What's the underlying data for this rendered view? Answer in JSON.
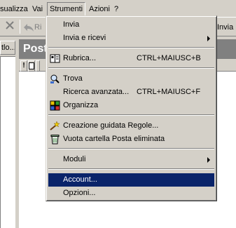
{
  "menubar": {
    "items": [
      {
        "label": "sualizza"
      },
      {
        "label": "Vai"
      },
      {
        "label": "Strumenti"
      },
      {
        "label": "Azioni"
      },
      {
        "label": "?"
      }
    ]
  },
  "toolbar": {
    "left_label": "Ri",
    "right_label": "Invia"
  },
  "leftpane": {
    "header": "tlo..."
  },
  "main": {
    "header": "Post",
    "columns": [
      "!",
      "☐",
      "✉"
    ]
  },
  "menu": {
    "items": [
      {
        "label": "Invia",
        "shortcut": "",
        "icon": "",
        "submenu": false
      },
      {
        "label": "Invia e ricevi",
        "shortcut": "",
        "icon": "",
        "submenu": true
      },
      {
        "label": "Rubrica...",
        "shortcut": "CTRL+MAIUSC+B",
        "icon": "address-book-icon",
        "submenu": false
      },
      {
        "label": "Trova",
        "shortcut": "",
        "icon": "find-icon",
        "submenu": false
      },
      {
        "label": "Ricerca avanzata...",
        "shortcut": "CTRL+MAIUSC+F",
        "icon": "",
        "submenu": false
      },
      {
        "label": "Organizza",
        "shortcut": "",
        "icon": "organize-icon",
        "submenu": false
      },
      {
        "label": "Creazione guidata Regole...",
        "shortcut": "",
        "icon": "rules-wizard-icon",
        "submenu": false
      },
      {
        "label": "Vuota cartella Posta eliminata",
        "shortcut": "",
        "icon": "recycle-bin-icon",
        "submenu": false
      },
      {
        "label": "Moduli",
        "shortcut": "",
        "icon": "",
        "submenu": true
      },
      {
        "label": "Account...",
        "shortcut": "",
        "icon": "",
        "submenu": false,
        "highlighted": true
      },
      {
        "label": "Opzioni...",
        "shortcut": "",
        "icon": "",
        "submenu": false
      }
    ]
  },
  "colors": {
    "highlight": "#0a246a",
    "face": "#d4d0c8",
    "shadow": "#808080"
  }
}
